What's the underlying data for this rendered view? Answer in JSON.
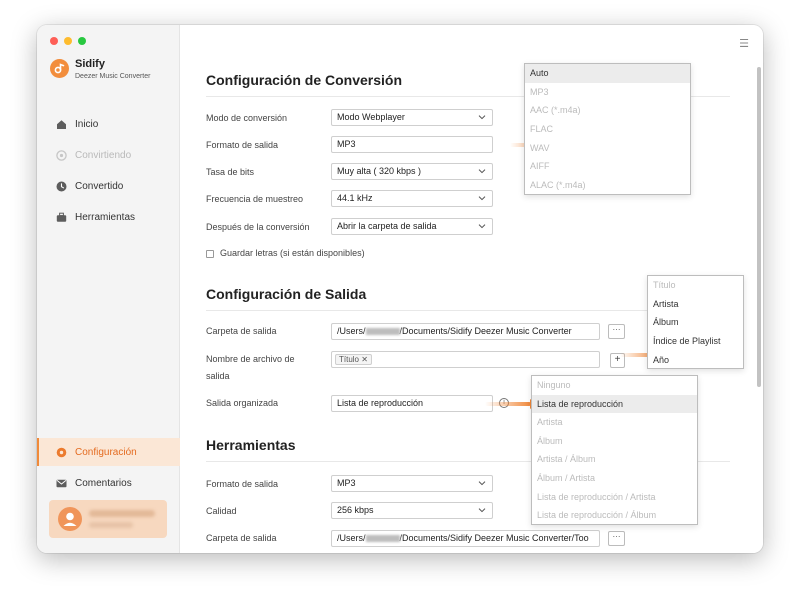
{
  "app": {
    "name": "Sidify",
    "subtitle": "Deezer Music Converter"
  },
  "sidebar": {
    "items": [
      {
        "label": "Inicio",
        "icon": "home-icon",
        "state": "normal"
      },
      {
        "label": "Convirtiendo",
        "icon": "converting-icon",
        "state": "disabled"
      },
      {
        "label": "Convertido",
        "icon": "clock-icon",
        "state": "normal"
      },
      {
        "label": "Herramientas",
        "icon": "toolbox-icon",
        "state": "normal"
      }
    ],
    "bottom_items": [
      {
        "label": "Configuración",
        "icon": "gear-icon",
        "state": "active"
      },
      {
        "label": "Comentarios",
        "icon": "mail-icon",
        "state": "normal"
      }
    ]
  },
  "conversion": {
    "title": "Configuración de Conversión",
    "mode_label": "Modo de conversión",
    "mode_value": "Modo Webplayer",
    "format_label": "Formato de salida",
    "format_value": "MP3",
    "bitrate_label": "Tasa de bits",
    "bitrate_value": "Muy alta ( 320 kbps )",
    "samplerate_label": "Frecuencia de muestreo",
    "samplerate_value": "44.1 kHz",
    "after_label": "Después de la conversión",
    "after_value": "Abrir la carpeta de salida",
    "lyrics_label": "Guardar letras (si están disponibles)"
  },
  "format_dropdown": {
    "options": [
      "Auto",
      "MP3",
      "AAC (*.m4a)",
      "FLAC",
      "WAV",
      "AIFF",
      "ALAC (*.m4a)"
    ],
    "selected": "Auto"
  },
  "output": {
    "title": "Configuración de Salida",
    "folder_label": "Carpeta de salida",
    "folder_prefix": "/Users/",
    "folder_suffix": "/Documents/Sidify Deezer Music Converter",
    "filename_label_line1": "Nombre de archivo de",
    "filename_label_line2": "salida",
    "filename_tag": "Título",
    "organized_label": "Salida organizada",
    "organized_value": "Lista de reproducción",
    "browse_label": "···",
    "add_label": "+",
    "info_label": "i"
  },
  "filename_dropdown": {
    "options": [
      "Título",
      "Artista",
      "Álbum",
      "Índice de Playlist",
      "Año"
    ],
    "disabled": [
      "Título"
    ]
  },
  "organized_dropdown": {
    "options": [
      "Ninguno",
      "Lista de reproducción",
      "Artista",
      "Álbum",
      "Artista / Álbum",
      "Álbum / Artista",
      "Lista de reproducción / Artista",
      "Lista de reproducción / Álbum"
    ],
    "selected": "Lista de reproducción"
  },
  "tools": {
    "title": "Herramientas",
    "format_label": "Formato de salida",
    "format_value": "MP3",
    "quality_label": "Calidad",
    "quality_value": "256 kbps",
    "folder_label": "Carpeta de salida",
    "folder_prefix": "/Users/",
    "folder_suffix": "/Documents/Sidify Deezer Music Converter/Too"
  },
  "colors": {
    "accent": "#f0883a",
    "sidebar_bg": "#f4f4f4",
    "active_bg": "#fbe7d6"
  }
}
